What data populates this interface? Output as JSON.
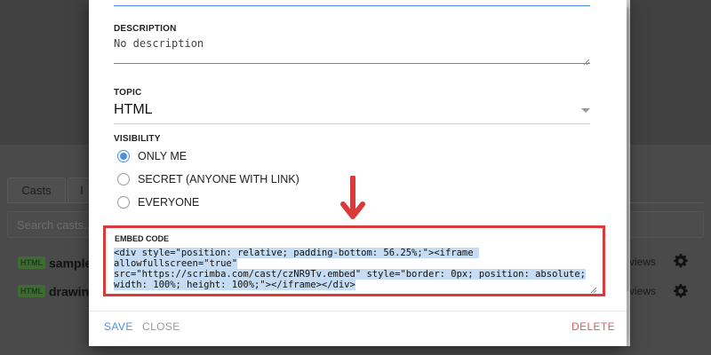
{
  "background": {
    "tabs": [
      "Casts",
      "I"
    ],
    "search_placeholder": "Search casts...",
    "rows": [
      {
        "tag": "HTML",
        "name": "samplec",
        "views": "views"
      },
      {
        "tag": "HTML",
        "name": "drawing",
        "views": "views"
      }
    ]
  },
  "dialog": {
    "description": {
      "label": "DESCRIPTION",
      "value": "No description"
    },
    "topic": {
      "label": "TOPIC",
      "value": "HTML"
    },
    "visibility": {
      "label": "VISIBILITY",
      "options": [
        "ONLY ME",
        "SECRET (ANYONE WITH LINK)",
        "EVERYONE"
      ],
      "selected": "ONLY ME"
    },
    "embed": {
      "label": "EMBED CODE",
      "code_lines": [
        "<div style=\"position: relative; padding-bottom: 56.25%;\"><iframe allowfullscreen=\"true\"",
        "src=\"https://scrimba.com/cast/czNR9Tv.embed\" style=\"border: 0px; position: absolute;",
        "width: 100%; height: 100%;\"></iframe></div>"
      ]
    },
    "footer": {
      "save": "SAVE",
      "close": "CLOSE",
      "delete": "DELETE"
    }
  },
  "colors": {
    "accent": "#4a90e2",
    "highlight_border": "#d93a3a",
    "danger": "#e05a5a"
  },
  "icons": [
    "gear-icon",
    "arrow-down-icon",
    "dropdown-arrow-icon",
    "resize-grip-icon"
  ]
}
